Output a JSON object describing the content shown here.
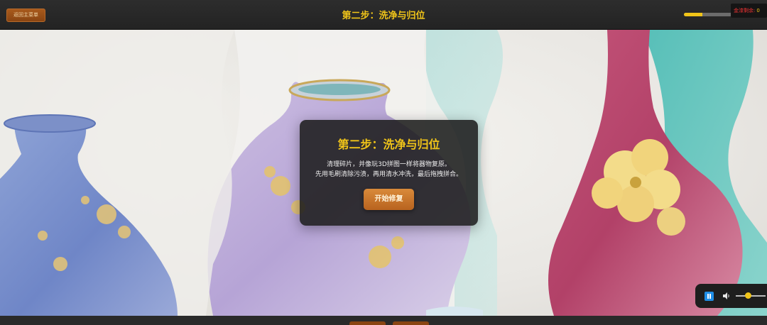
{
  "top_bar": {
    "back_label": "返回主菜单",
    "title": "第二步：洗净与归位",
    "progress": 0.37,
    "gold_label": "金漆剩余:",
    "gold_value": "0"
  },
  "modal": {
    "title": "第二步：洗净与归位",
    "line1": "清理碎片，并像玩3D拼图一样将器物复原。",
    "line2": "先用毛刷清除污渍，再用清水冲洗，最后拖拽拼合。",
    "button_label": "开始修复"
  },
  "music": {
    "playing": true,
    "volume": 0.4
  },
  "colors": {
    "accent_gold": "#f0c419",
    "button_orange": "#c97a30",
    "back_button_brown": "#9a4f17",
    "play_blue": "#1f8ee6"
  }
}
